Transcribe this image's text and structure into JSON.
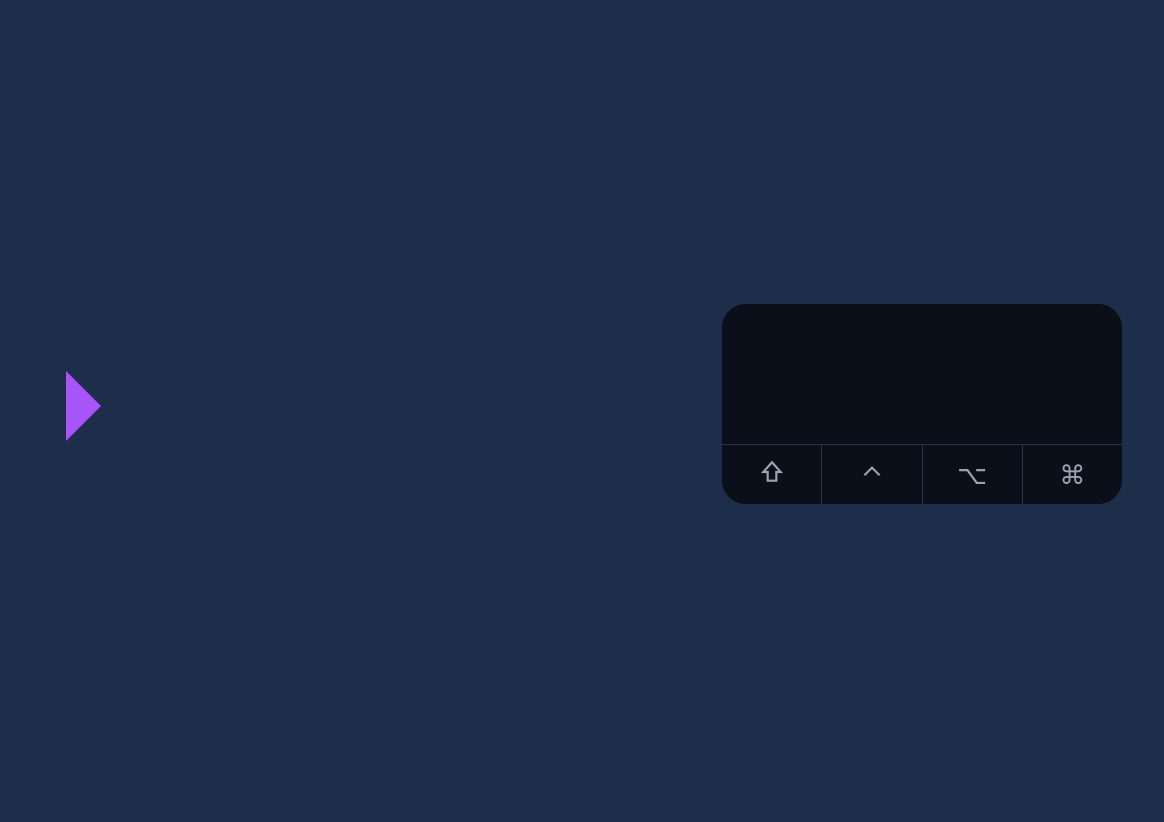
{
  "colors": {
    "background": "#1c2e4a",
    "panel_bg": "#0a0f1a",
    "border": "#2a3548",
    "icon": "#9ca3af",
    "accent": "#a855f7"
  },
  "expand_handle": {
    "icon": "caret-right-icon"
  },
  "shortcut_panel": {
    "display_value": "",
    "modifier_keys": [
      {
        "name": "shift",
        "glyph": "⇧",
        "label": "Shift"
      },
      {
        "name": "control",
        "glyph": "⌃",
        "label": "Control"
      },
      {
        "name": "option",
        "glyph": "⌥",
        "label": "Option"
      },
      {
        "name": "command",
        "glyph": "⌘",
        "label": "Command"
      }
    ]
  }
}
